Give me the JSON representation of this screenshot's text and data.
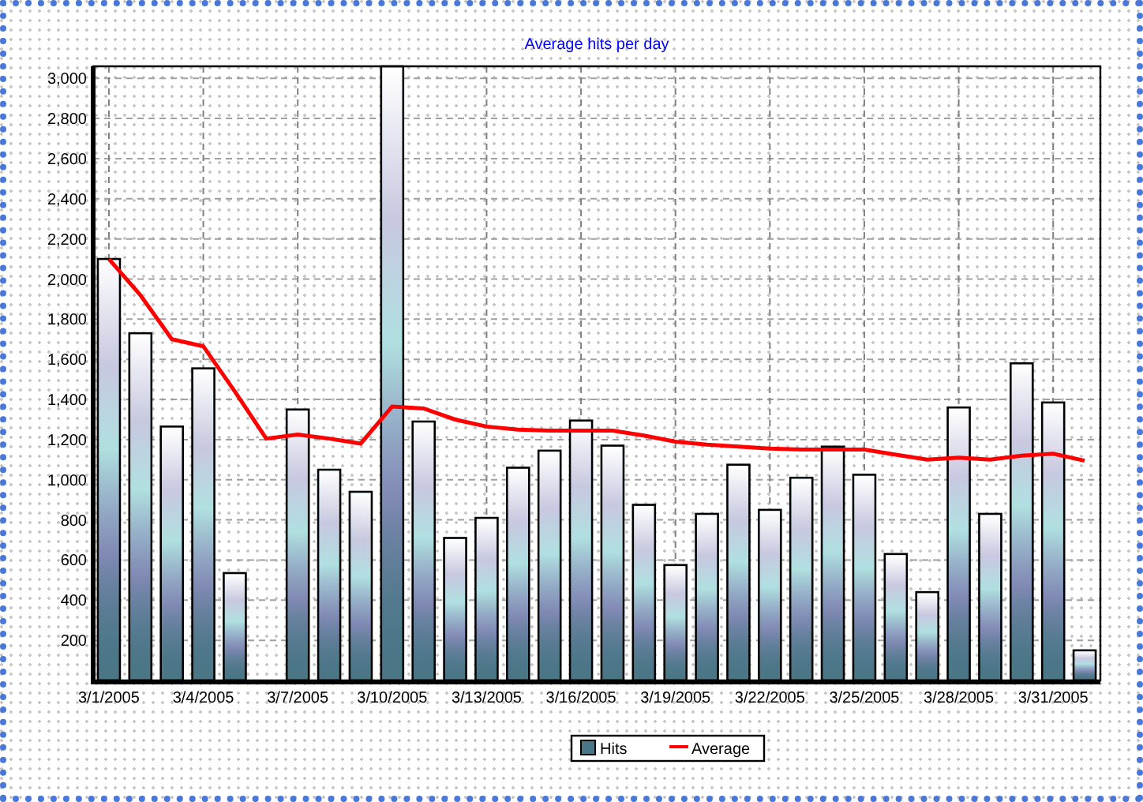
{
  "chart_data": {
    "type": "bar",
    "title": "Average hits per day",
    "categories": [
      "3/1/2005",
      null,
      null,
      "3/4/2005",
      null,
      null,
      "3/7/2005",
      null,
      null,
      "3/10/2005",
      null,
      null,
      "3/13/2005",
      null,
      null,
      "3/16/2005",
      null,
      null,
      "3/19/2005",
      null,
      null,
      "3/22/2005",
      null,
      null,
      "3/25/2005",
      null,
      null,
      "3/28/2005",
      null,
      null,
      "3/31/2005",
      null
    ],
    "grid": true,
    "legend": true,
    "series": [
      {
        "name": "Hits",
        "color": "#4a7686",
        "values": [
          2100,
          1730,
          1265,
          1555,
          535,
          null,
          1350,
          1050,
          940,
          3060,
          1290,
          710,
          810,
          1060,
          1145,
          1295,
          1170,
          875,
          575,
          830,
          1075,
          850,
          1010,
          1165,
          1025,
          630,
          440,
          1360,
          830,
          1580,
          1385,
          150
        ]
      },
      {
        "name": "Average",
        "type": "line",
        "color": "#ff0000",
        "values": [
          2100,
          1920,
          1700,
          1665,
          1440,
          1205,
          1225,
          1205,
          1180,
          1365,
          1355,
          1300,
          1265,
          1250,
          1245,
          1245,
          1245,
          1220,
          1190,
          1175,
          1165,
          1155,
          1150,
          1150,
          1150,
          1125,
          1100,
          1110,
          1100,
          1120,
          1130,
          1095
        ]
      }
    ],
    "ylim": [
      0,
      3060
    ],
    "yticks": [
      {
        "value": 200,
        "label": "200"
      },
      {
        "value": 400,
        "label": "400"
      },
      {
        "value": 600,
        "label": "600"
      },
      {
        "value": 800,
        "label": "800"
      },
      {
        "value": 1000,
        "label": "1,000"
      },
      {
        "value": 1200,
        "label": "1,200"
      },
      {
        "value": 1400,
        "label": "1,400"
      },
      {
        "value": 1600,
        "label": "1,600"
      },
      {
        "value": 1800,
        "label": "1,800"
      },
      {
        "value": 2000,
        "label": "2,000"
      },
      {
        "value": 2200,
        "label": "2,200"
      },
      {
        "value": 2400,
        "label": "2,400"
      },
      {
        "value": 2600,
        "label": "2,600"
      },
      {
        "value": 2800,
        "label": "2,800"
      },
      {
        "value": 3000,
        "label": "3,000"
      }
    ]
  }
}
